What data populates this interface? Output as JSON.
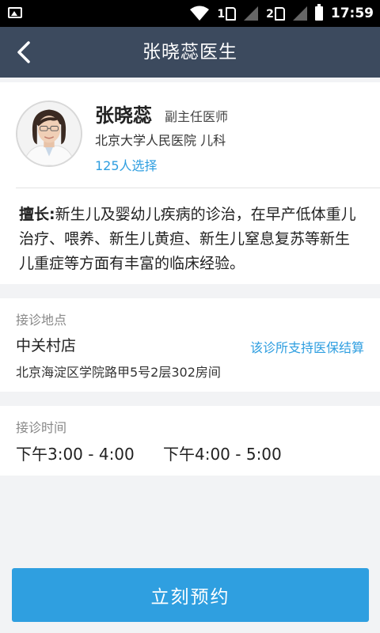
{
  "status_bar": {
    "sim1": "1",
    "sim2": "2",
    "time": "17:59"
  },
  "nav": {
    "back_icon": "chevron-left-icon",
    "title": "张晓蕊医生"
  },
  "doctor": {
    "name": "张晓蕊",
    "title": "副主任医师",
    "hospital": "北京大学人民医院 儿科",
    "choose_count": "125人选择",
    "specialty_label": "擅长:",
    "specialty_text": "新生儿及婴幼儿疾病的诊治，在早产低体重儿治疗、喂养、新生儿黄疸、新生儿窒息复苏等新生儿重症等方面有丰富的临床经验。"
  },
  "location": {
    "label": "接诊地点",
    "name": "中关村店",
    "insurance_link": "该诊所支持医保结算",
    "address": "北京海淀区学院路甲5号2层302房间"
  },
  "time": {
    "label": "接诊时间",
    "slots": [
      "下午3:00 - 4:00",
      "下午4:00 - 5:00"
    ]
  },
  "book_button": "立刻预约",
  "colors": {
    "navbar": "#3c4a5e",
    "accent": "#2f9fe0",
    "link": "#2e9ee0",
    "background": "#f2f3f5"
  }
}
